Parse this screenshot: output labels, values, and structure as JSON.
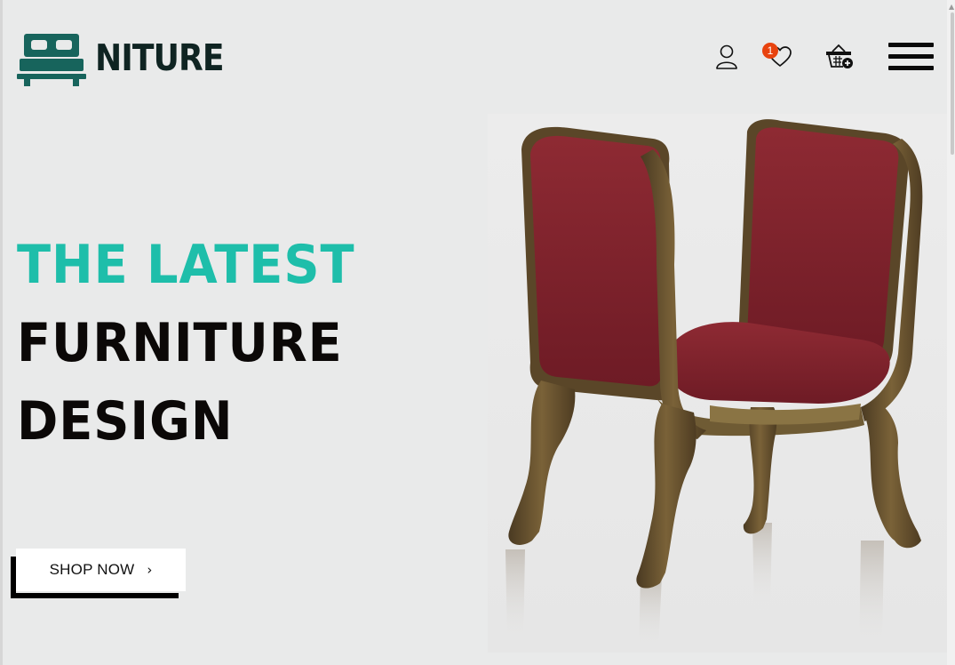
{
  "brand": {
    "name": "NITURE",
    "accent_color": "#1ebeaa",
    "logo_icon": "bed-icon",
    "logo_color": "#17645c"
  },
  "header": {
    "account_icon": "user-icon",
    "wishlist_icon": "heart-icon",
    "wishlist_count": "1",
    "cart_icon": "basket-icon",
    "menu_icon": "hamburger-menu-icon"
  },
  "hero": {
    "line1": "THE LATEST",
    "line2": "FURNITURE",
    "line3": "DESIGN",
    "cta_label": "SHOP NOW",
    "cta_arrow": "›"
  },
  "colors": {
    "background": "#e9eaea",
    "heading_dark": "#0b0807",
    "badge": "#e8430f"
  }
}
